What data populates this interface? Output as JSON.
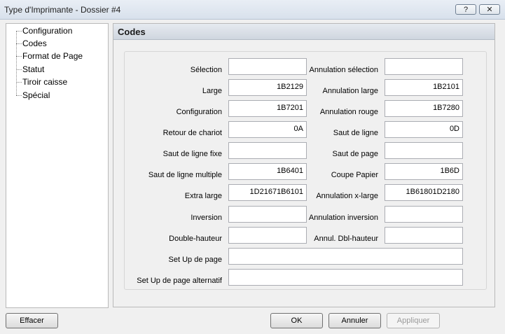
{
  "window": {
    "title": "Type d'Imprimante - Dossier #4",
    "help_label": "?",
    "close_label": "✕"
  },
  "tree": {
    "items": [
      "Configuration",
      "Codes",
      "Format de Page",
      "Statut",
      "Tiroir caisse",
      "Spécial"
    ]
  },
  "panel": {
    "title": "Codes"
  },
  "fields": {
    "selection": {
      "label": "Sélection",
      "value": ""
    },
    "annulation_selection": {
      "label": "Annulation sélection",
      "value": ""
    },
    "large": {
      "label": "Large",
      "value": "1B2129"
    },
    "annulation_large": {
      "label": "Annulation large",
      "value": "1B2101"
    },
    "configuration": {
      "label": "Configuration",
      "value": "1B7201"
    },
    "annulation_rouge": {
      "label": "Annulation rouge",
      "value": "1B7280"
    },
    "retour_chariot": {
      "label": "Retour de chariot",
      "value": "0A"
    },
    "saut_ligne": {
      "label": "Saut de ligne",
      "value": "0D"
    },
    "saut_ligne_fixe": {
      "label": "Saut de ligne fixe",
      "value": ""
    },
    "saut_page": {
      "label": "Saut de page",
      "value": ""
    },
    "saut_ligne_multiple": {
      "label": "Saut de ligne multiple",
      "value": "1B6401"
    },
    "coupe_papier": {
      "label": "Coupe Papier",
      "value": "1B6D"
    },
    "extra_large": {
      "label": "Extra large",
      "value": "1D21671B6101"
    },
    "annulation_xlarge": {
      "label": "Annulation x-large",
      "value": "1B61801D2180"
    },
    "inversion": {
      "label": "Inversion",
      "value": ""
    },
    "annulation_inversion": {
      "label": "Annulation inversion",
      "value": ""
    },
    "double_hauteur": {
      "label": "Double-hauteur",
      "value": ""
    },
    "annul_dbl_hauteur": {
      "label": "Annul. Dbl-hauteur",
      "value": ""
    },
    "setup_page": {
      "label": "Set Up de page",
      "value": ""
    },
    "setup_page_alt": {
      "label": "Set Up de page alternatif",
      "value": ""
    }
  },
  "buttons": {
    "effacer": "Effacer",
    "ok": "OK",
    "annuler": "Annuler",
    "appliquer": "Appliquer"
  }
}
